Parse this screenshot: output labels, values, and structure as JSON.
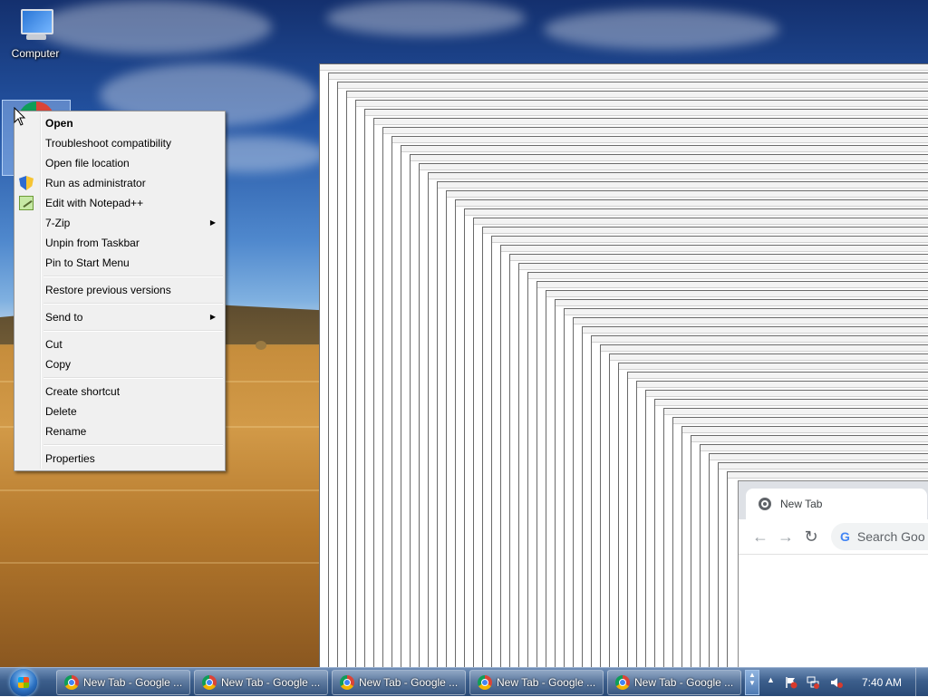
{
  "desktop": {
    "icons": [
      {
        "label": "Computer",
        "icon": "computer-icon"
      },
      {
        "label": "",
        "icon": "chrome-icon"
      }
    ]
  },
  "context_menu": {
    "items": [
      {
        "label": "Open",
        "bold": true
      },
      {
        "label": "Troubleshoot compatibility"
      },
      {
        "label": "Open file location"
      },
      {
        "label": "Run as administrator",
        "icon": "uac-shield-icon"
      },
      {
        "label": "Edit with Notepad++",
        "icon": "notepad-plus-plus-icon"
      },
      {
        "label": "7-Zip",
        "submenu": true
      },
      {
        "label": "Unpin from Taskbar"
      },
      {
        "label": "Pin to Start Menu"
      },
      {
        "label": "Restore previous versions"
      },
      {
        "label": "Send to",
        "submenu": true
      },
      {
        "label": "Cut"
      },
      {
        "label": "Copy"
      },
      {
        "label": "Create shortcut"
      },
      {
        "label": "Delete"
      },
      {
        "label": "Rename"
      },
      {
        "label": "Properties"
      }
    ]
  },
  "browser": {
    "tab_title": "New Tab",
    "omnibox_placeholder": "Search Goo"
  },
  "taskbar": {
    "buttons": [
      {
        "label": "New Tab - Google ..."
      },
      {
        "label": "New Tab - Google ..."
      },
      {
        "label": "New Tab - Google ..."
      },
      {
        "label": "New Tab - Google ..."
      },
      {
        "label": "New Tab - Google ..."
      }
    ],
    "clock": "7:40 AM"
  },
  "colors": {
    "taskbar": "#294a76",
    "menu_bg": "#f0f0f0",
    "chrome_blue": "#4285f4"
  }
}
